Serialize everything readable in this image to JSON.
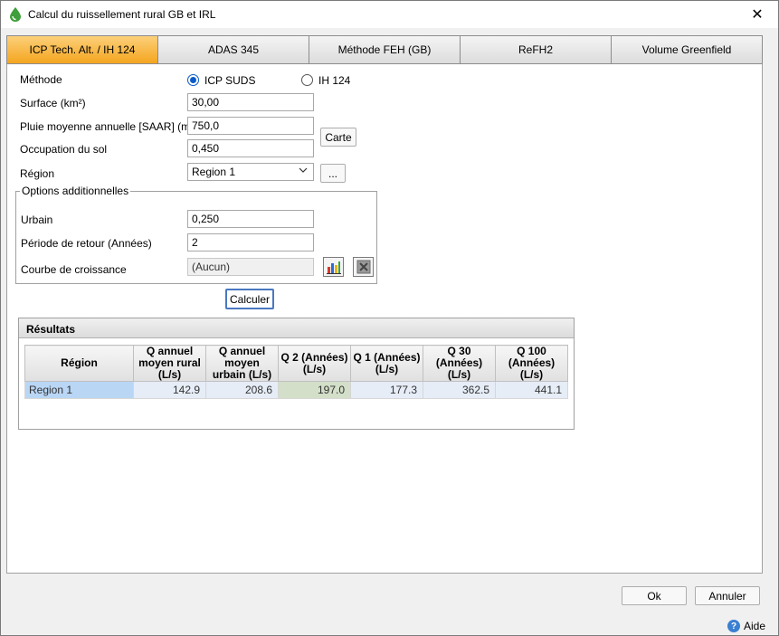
{
  "window": {
    "title": "Calcul du ruissellement rural GB et IRL",
    "close_glyph": "✕"
  },
  "tabs": [
    {
      "label": "ICP Tech. Alt. / IH 124",
      "active": true
    },
    {
      "label": "ADAS 345",
      "active": false
    },
    {
      "label": "Méthode FEH (GB)",
      "active": false
    },
    {
      "label": "ReFH2",
      "active": false
    },
    {
      "label": "Volume Greenfield",
      "active": false
    }
  ],
  "form": {
    "methode_label": "Méthode",
    "radio_icp": "ICP SUDS",
    "radio_ih": "IH 124",
    "selected_method": "ICP SUDS",
    "surface_label": "Surface (km²)",
    "surface_value": "30,00",
    "saar_label": "Pluie moyenne annuelle [SAAR] (mm)",
    "saar_value": "750,0",
    "occupation_label": "Occupation du sol",
    "occupation_value": "0,450",
    "region_label": "Région",
    "region_value": "Region 1",
    "carte_button": "Carte",
    "ellipsis_button": "..."
  },
  "options": {
    "title": "Options additionnelles",
    "urbain_label": "Urbain",
    "urbain_value": "0,250",
    "periode_label": "Période de retour (Années)",
    "periode_value": "2",
    "courbe_label": "Courbe de croissance",
    "courbe_value": "(Aucun)"
  },
  "calculer_button": "Calculer",
  "results": {
    "title": "Résultats",
    "headers": [
      "Région",
      "Q annuel moyen rural (L/s)",
      "Q annuel moyen urbain (L/s)",
      "Q 2 (Années) (L/s)",
      "Q 1 (Années) (L/s)",
      "Q 30 (Années) (L/s)",
      "Q 100 (Années) (L/s)"
    ],
    "rows": [
      [
        "Region 1",
        "142.9",
        "208.6",
        "197.0",
        "177.3",
        "362.5",
        "441.1"
      ]
    ]
  },
  "footer": {
    "ok": "Ok",
    "annuler": "Annuler",
    "aide": "Aide",
    "aide_glyph": "?"
  },
  "colors": {
    "active_tab": "#f4a51f",
    "accent": "#0a5ac9"
  }
}
